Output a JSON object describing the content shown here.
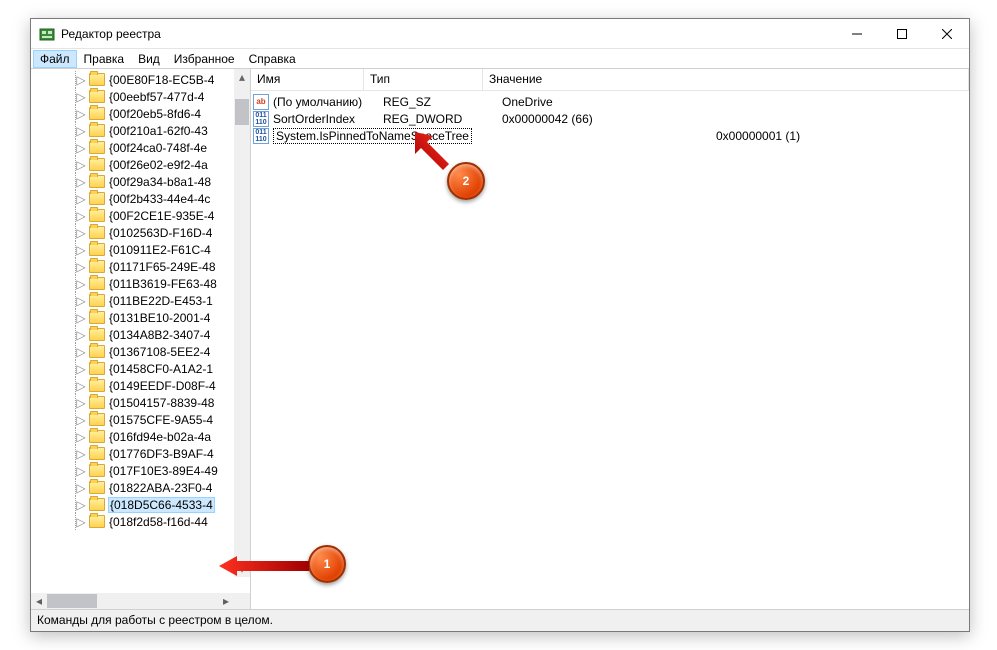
{
  "titlebar": {
    "title": "Редактор реестра"
  },
  "menu": {
    "file": "Файл",
    "edit": "Правка",
    "view": "Вид",
    "favorites": "Избранное",
    "help": "Справка"
  },
  "tree": {
    "items": [
      {
        "label": "{00E80F18-EC5B-4",
        "selected": false
      },
      {
        "label": "{00eebf57-477d-4",
        "selected": false
      },
      {
        "label": "{00f20eb5-8fd6-4",
        "selected": false
      },
      {
        "label": "{00f210a1-62f0-43",
        "selected": false
      },
      {
        "label": "{00f24ca0-748f-4e",
        "selected": false
      },
      {
        "label": "{00f26e02-e9f2-4a",
        "selected": false
      },
      {
        "label": "{00f29a34-b8a1-48",
        "selected": false
      },
      {
        "label": "{00f2b433-44e4-4c",
        "selected": false
      },
      {
        "label": "{00F2CE1E-935E-4",
        "selected": false
      },
      {
        "label": "{0102563D-F16D-4",
        "selected": false
      },
      {
        "label": "{010911E2-F61C-4",
        "selected": false
      },
      {
        "label": "{01171F65-249E-48",
        "selected": false
      },
      {
        "label": "{011B3619-FE63-48",
        "selected": false
      },
      {
        "label": "{011BE22D-E453-1",
        "selected": false
      },
      {
        "label": "{0131BE10-2001-4",
        "selected": false
      },
      {
        "label": "{0134A8B2-3407-4",
        "selected": false
      },
      {
        "label": "{01367108-5EE2-4",
        "selected": false
      },
      {
        "label": "{01458CF0-A1A2-1",
        "selected": false
      },
      {
        "label": "{0149EEDF-D08F-4",
        "selected": false
      },
      {
        "label": "{01504157-8839-48",
        "selected": false
      },
      {
        "label": "{01575CFE-9A55-4",
        "selected": false
      },
      {
        "label": "{016fd94e-b02a-4a",
        "selected": false
      },
      {
        "label": "{01776DF3-B9AF-4",
        "selected": false
      },
      {
        "label": "{017F10E3-89E4-49",
        "selected": false
      },
      {
        "label": "{01822ABA-23F0-4",
        "selected": false
      },
      {
        "label": "{018D5C66-4533-4",
        "selected": true
      },
      {
        "label": "{018f2d58-f16d-44",
        "selected": false
      }
    ]
  },
  "columns": {
    "name": "Имя",
    "type": "Тип",
    "value": "Значение"
  },
  "rows": [
    {
      "icon": "ab",
      "name": "(По умолчанию)",
      "type": "REG_SZ",
      "value": "OneDrive",
      "renaming": false
    },
    {
      "icon": "bin",
      "name": "SortOrderIndex",
      "type": "REG_DWORD",
      "value": "0x00000042 (66)",
      "renaming": false
    },
    {
      "icon": "bin",
      "name": "System.IsPinnedToNameSpaceTree",
      "type": "",
      "value": "0x00000001 (1)",
      "renaming": true
    }
  ],
  "statusbar": {
    "text": "Команды для работы с реестром в целом."
  },
  "callouts": {
    "one": "1",
    "two": "2"
  }
}
